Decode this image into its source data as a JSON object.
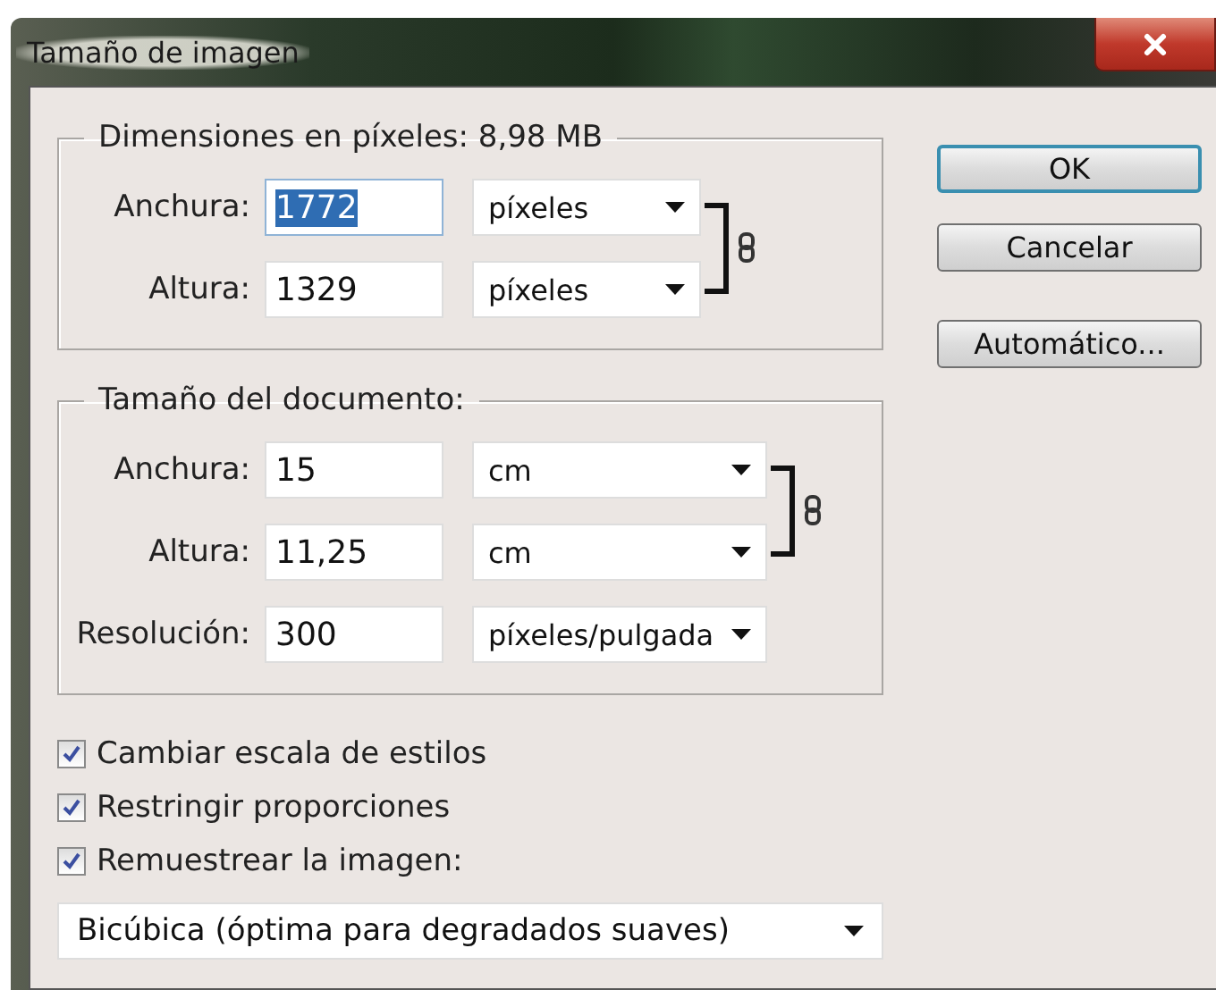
{
  "window": {
    "title": "Tamaño de imagen"
  },
  "pixel_dimensions": {
    "legend": "Dimensiones en píxeles: 8,98 MB",
    "fields": [
      {
        "label": "Anchura:",
        "value": "1772",
        "text_selected": true,
        "unit": "píxeles"
      },
      {
        "label": "Altura:",
        "value": "1329",
        "text_selected": false,
        "unit": "píxeles"
      }
    ]
  },
  "document_size": {
    "legend": "Tamaño del documento:",
    "fields": [
      {
        "label": "Anchura:",
        "value": "15",
        "text_selected": false,
        "unit": "cm",
        "linked": true
      },
      {
        "label": "Altura:",
        "value": "11,25",
        "text_selected": false,
        "unit": "cm",
        "linked": true
      },
      {
        "label": "Resolución:",
        "value": "300",
        "text_selected": false,
        "unit": "píxeles/pulgada",
        "linked": false
      }
    ]
  },
  "options": [
    {
      "label": "Cambiar escala de estilos",
      "checked": true
    },
    {
      "label": "Restringir proporciones",
      "checked": true
    },
    {
      "label": "Remuestrear la imagen:",
      "checked": true
    }
  ],
  "resample_method": "Bicúbica (óptima para degradados suaves)",
  "buttons": [
    {
      "label": "OK",
      "default": true
    },
    {
      "label": "Cancelar",
      "default": false
    },
    {
      "label": "Automático...",
      "default": false
    }
  ]
}
